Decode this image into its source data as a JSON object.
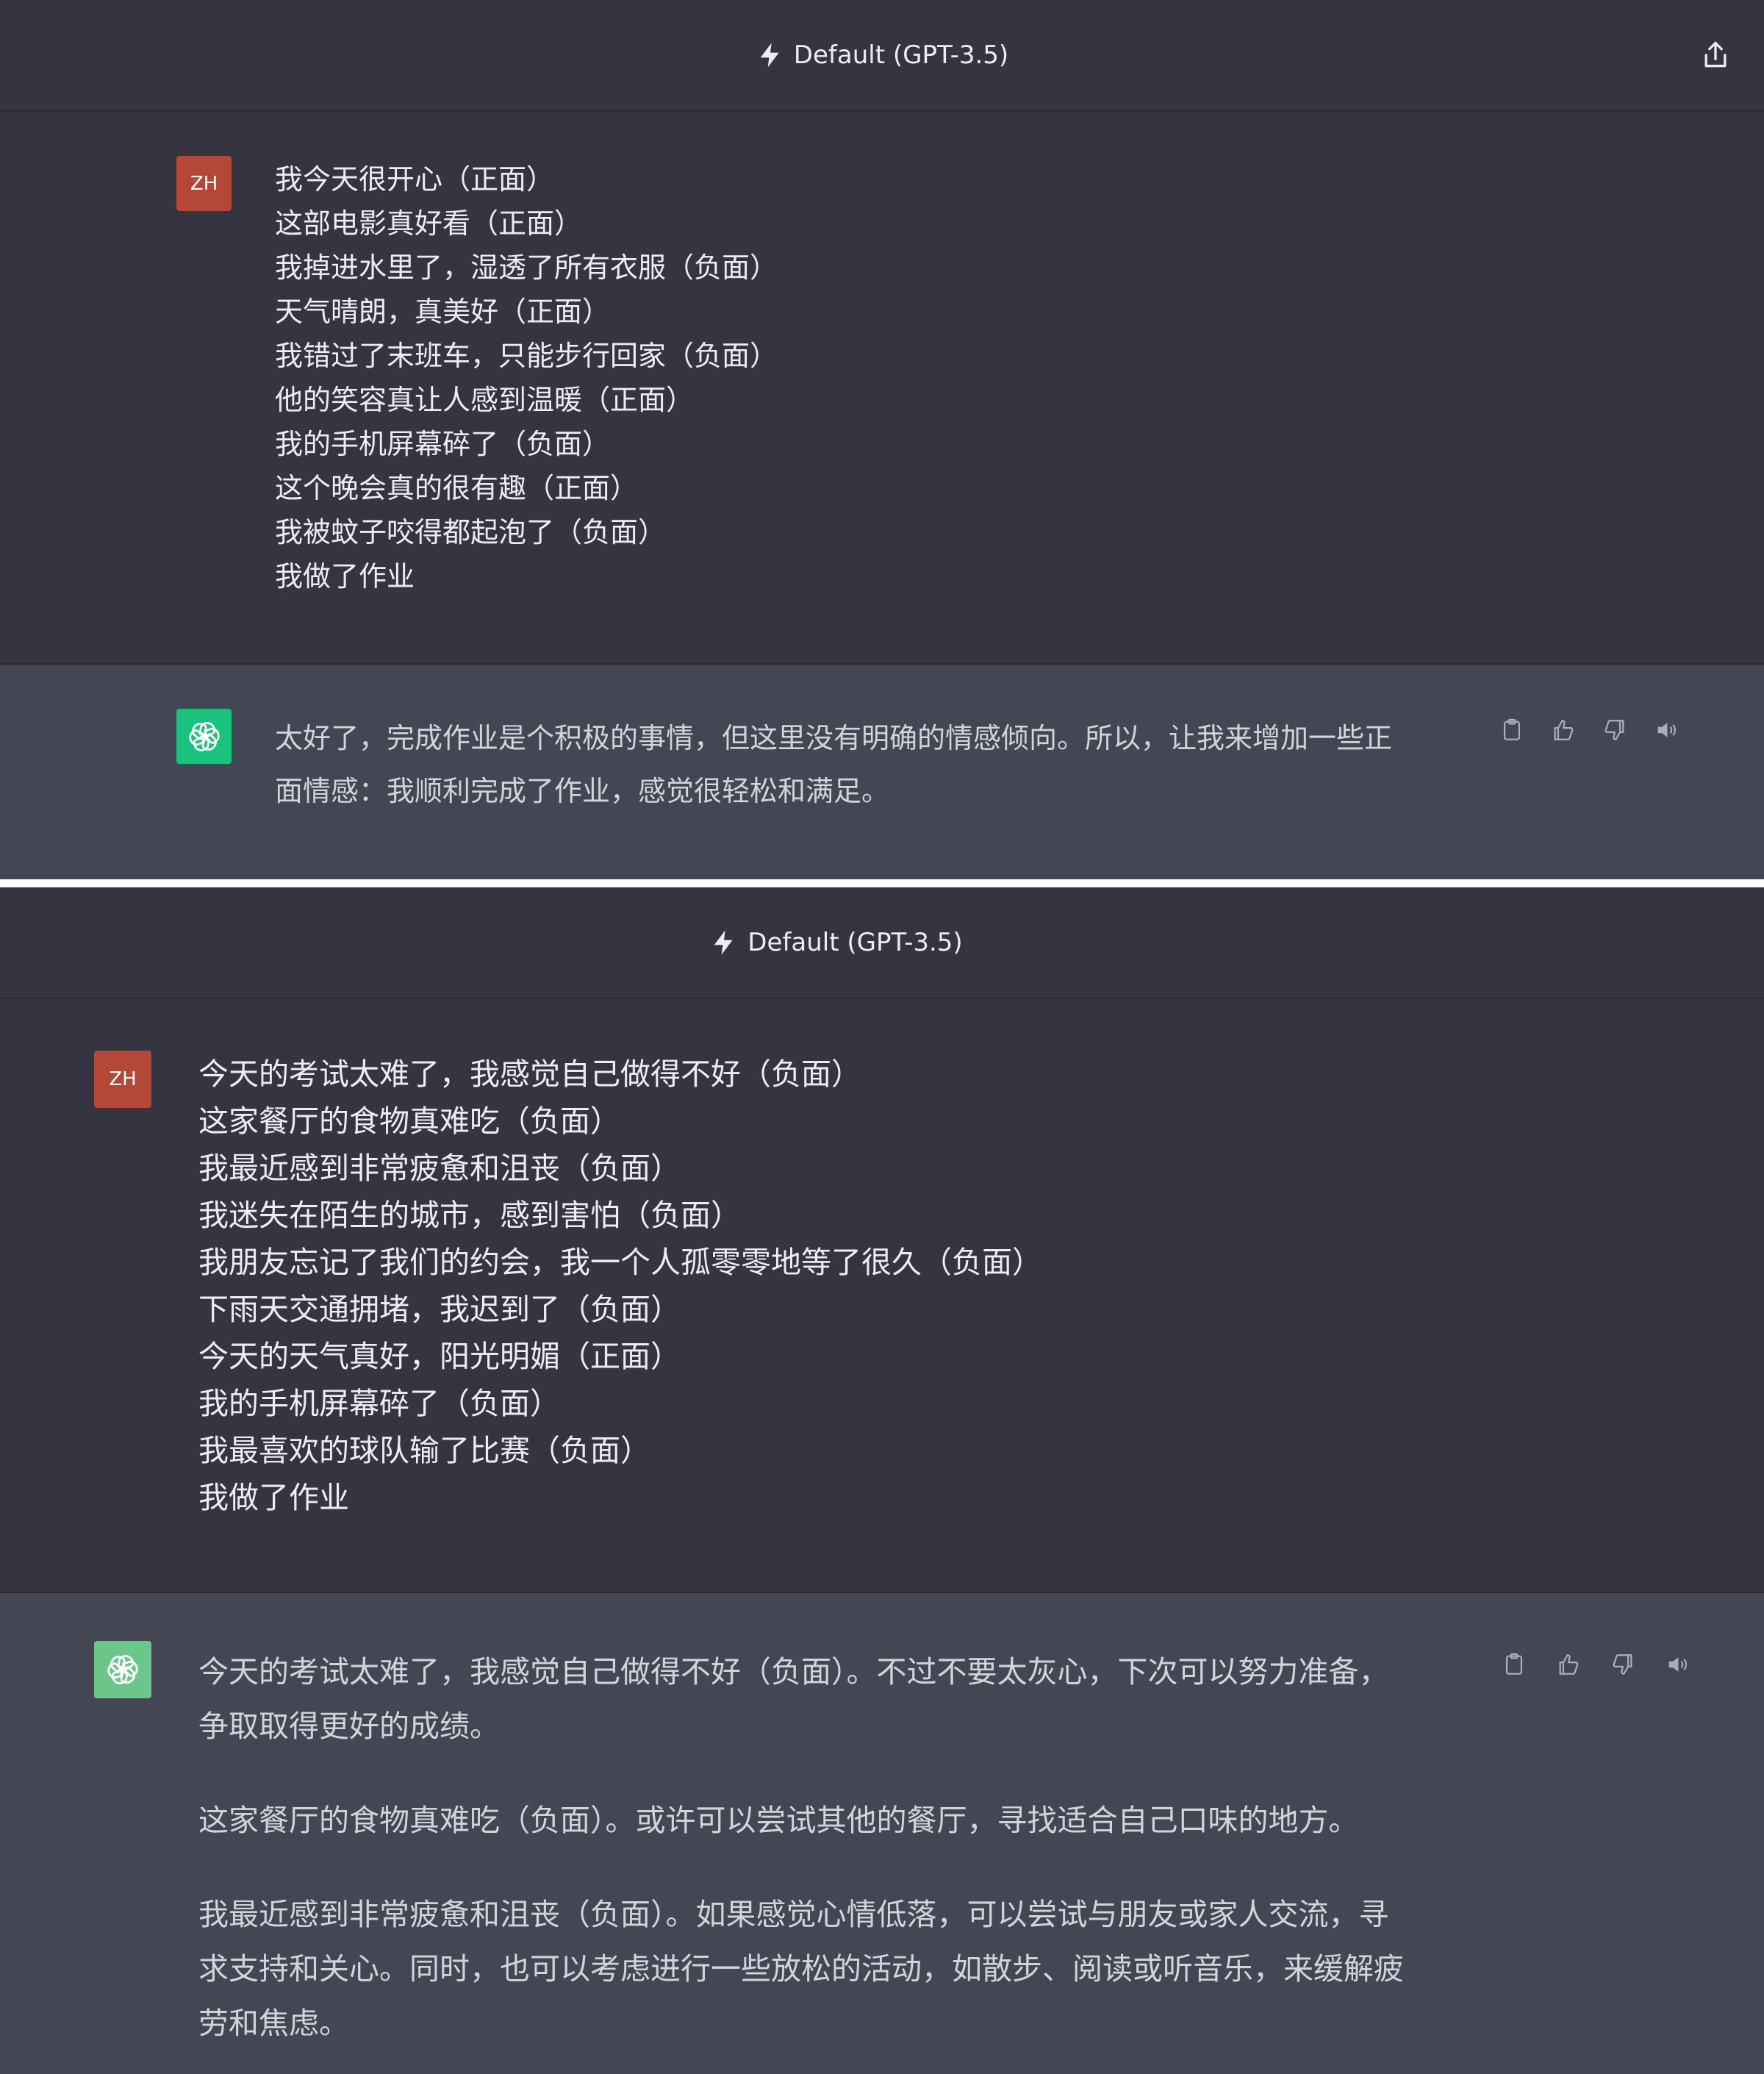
{
  "colors": {
    "header_bg": "#343541",
    "user_bg": "#343541",
    "assistant_bg": "#444654",
    "user_avatar": "#b54736",
    "gpt_avatar": "#19c37d",
    "text": "#ececf1"
  },
  "panel1": {
    "header": {
      "title": "Default (GPT-3.5)",
      "icon": "bolt-icon",
      "share_icon": "share-icon"
    },
    "user": {
      "avatar": "ZH",
      "lines": [
        "我今天很开心（正面）",
        "这部电影真好看（正面）",
        "我掉进水里了，湿透了所有衣服（负面）",
        "天气晴朗，真美好（正面）",
        "我错过了末班车，只能步行回家（负面）",
        "他的笑容真让人感到温暖（正面）",
        "我的手机屏幕碎了（负面）",
        "这个晚会真的很有趣（正面）",
        "我被蚊子咬得都起泡了（负面）",
        "我做了作业"
      ]
    },
    "assistant": {
      "lines": [
        "太好了，完成作业是个积极的事情，但这里没有明确的情感倾向。所以，让我来增加一些正",
        "面情感：我顺利完成了作业，感觉很轻松和满足。"
      ],
      "actions": [
        "clipboard-icon",
        "thumbs-up-icon",
        "thumbs-down-icon",
        "speaker-icon"
      ]
    }
  },
  "panel2": {
    "header": {
      "title": "Default (GPT-3.5)",
      "icon": "bolt-icon"
    },
    "user": {
      "avatar": "ZH",
      "lines": [
        "今天的考试太难了，我感觉自己做得不好（负面）",
        "这家餐厅的食物真难吃（负面）",
        "我最近感到非常疲惫和沮丧（负面）",
        "我迷失在陌生的城市，感到害怕（负面）",
        "我朋友忘记了我们的约会，我一个人孤零零地等了很久（负面）",
        "下雨天交通拥堵，我迟到了（负面）",
        "今天的天气真好，阳光明媚（正面）",
        "我的手机屏幕碎了（负面）",
        "我最喜欢的球队输了比赛（负面）",
        "我做了作业"
      ]
    },
    "assistant": {
      "paragraph1": [
        "今天的考试太难了，我感觉自己做得不好（负面）。不过不要太灰心，下次可以努力准备，",
        "争取取得更好的成绩。"
      ],
      "paragraph2": [
        "这家餐厅的食物真难吃（负面）。或许可以尝试其他的餐厅，寻找适合自己口味的地方。"
      ],
      "paragraph3": [
        "我最近感到非常疲惫和沮丧（负面）。如果感觉心情低落，可以尝试与朋友或家人交流，寻",
        "求支持和关心。同时，也可以考虑进行一些放松的活动，如散步、阅读或听音乐，来缓解疲",
        "劳和焦虑。"
      ],
      "actions": [
        "clipboard-icon",
        "thumbs-up-icon",
        "thumbs-down-icon",
        "speaker-icon"
      ]
    }
  }
}
